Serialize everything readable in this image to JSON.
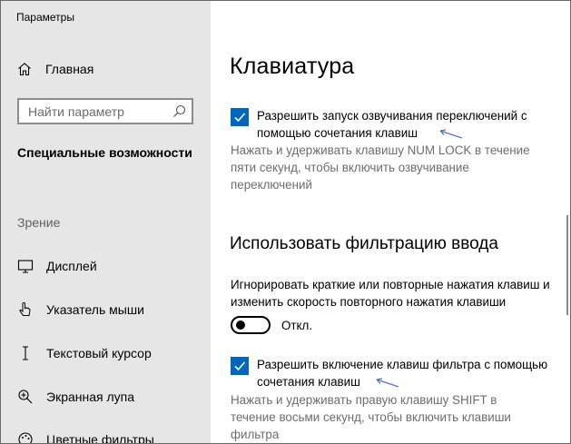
{
  "window": {
    "title": "Параметры"
  },
  "sidebar": {
    "home_label": "Главная",
    "search_placeholder": "Найти параметр",
    "section_title": "Специальные возможности",
    "group_label": "Зрение",
    "items": [
      {
        "label": "Дисплей",
        "icon": "display-icon"
      },
      {
        "label": "Указатель мыши",
        "icon": "mouse-pointer-icon"
      },
      {
        "label": "Текстовый курсор",
        "icon": "text-cursor-icon"
      },
      {
        "label": "Экранная лупа",
        "icon": "magnifier-icon"
      },
      {
        "label": "Цветные фильтры",
        "icon": "color-filters-icon"
      }
    ]
  },
  "main": {
    "page_title": "Клавиатура",
    "togglekeys": {
      "checkbox_label": "Разрешить запуск озвучивания переключений с помощью сочетания клавиш",
      "checked": true,
      "description": "Нажать и удерживать клавишу NUM LOCK в течение пяти секунд, чтобы включить озвучивание переключений"
    },
    "filter": {
      "header": "Использовать фильтрацию ввода",
      "text": "Игнорировать краткие или повторные нажатия клавиш и изменить скорость повторного нажатия клавиши",
      "toggle_state": "Откл.",
      "toggle_on": false,
      "checkbox_label": "Разрешить включение клавиш фильтра с помощью сочетания клавиш",
      "checked": true,
      "description": "Нажать и удерживать правую клавишу SHIFT в течение восьми секунд, чтобы включить клавиши фильтра"
    }
  },
  "colors": {
    "accent": "#0067c0",
    "sidebar_bg": "#e6e6e6",
    "muted_text": "#6d6d6d"
  }
}
